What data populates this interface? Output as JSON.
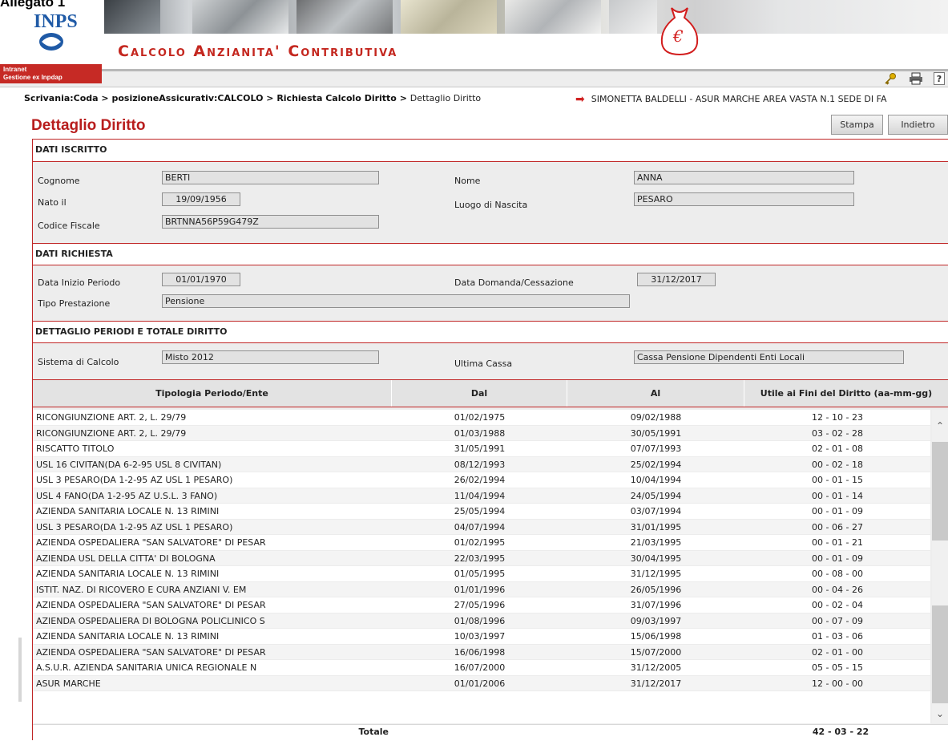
{
  "header": {
    "allegato": "Allegato 1",
    "logo_text": "INPS",
    "intranet_line1": "Intranet",
    "intranet_line2": "Gestione ex Inpdap",
    "app_title": "Calcolo Anzianita' Contributiva",
    "icons": [
      "key-icon",
      "print-icon",
      "help-icon"
    ],
    "help_label": "?"
  },
  "breadcrumb": {
    "items": [
      "Scrivania:Coda",
      "posizioneAssicurativ:CALCOLO",
      "Richiesta Calcolo Diritto",
      "Dettaglio Diritto"
    ],
    "separator": " > "
  },
  "user": {
    "text": "SIMONETTA BALDELLI  - ASUR MARCHE AREA VASTA N.1 SEDE DI FA"
  },
  "page": {
    "title": "Dettaglio Diritto",
    "buttons": {
      "stampa": "Stampa",
      "indietro": "Indietro"
    }
  },
  "iscritto": {
    "section_title": "DATI ISCRITTO",
    "cognome_label": "Cognome",
    "cognome": "BERTI",
    "nome_label": "Nome",
    "nome": "ANNA",
    "nato_label": "Nato il",
    "nato": "19/09/1956",
    "luogo_label": "Luogo di Nascita",
    "luogo": "PESARO",
    "cf_label": "Codice Fiscale",
    "cf": "BRTNNA56P59G479Z"
  },
  "richiesta": {
    "section_title": "DATI RICHIESTA",
    "inizio_label": "Data Inizio Periodo",
    "inizio": "01/01/1970",
    "domanda_label": "Data Domanda/Cessazione",
    "domanda": "31/12/2017",
    "tipo_label": "Tipo Prestazione",
    "tipo": "Pensione"
  },
  "dettaglio": {
    "section_title": "DETTAGLIO PERIODI E TOTALE DIRITTO",
    "sistema_label": "Sistema di Calcolo",
    "sistema": "Misto 2012",
    "cassa_label": "Ultima Cassa",
    "cassa": "Cassa Pensione Dipendenti Enti Locali"
  },
  "table": {
    "headers": [
      "Tipologia Periodo/Ente",
      "Dal",
      "Al",
      "Utile ai Fini del Diritto (aa-mm-gg)"
    ],
    "rows": [
      [
        "RICONGIUNZIONE ART. 2, L. 29/79",
        "01/02/1975",
        "09/02/1988",
        "12 - 10 - 23"
      ],
      [
        "RICONGIUNZIONE ART. 2, L. 29/79",
        "01/03/1988",
        "30/05/1991",
        "03 - 02 - 28"
      ],
      [
        "RISCATTO TITOLO",
        "31/05/1991",
        "07/07/1993",
        "02 - 01 - 08"
      ],
      [
        "USL 16 CIVITAN(DA 6-2-95 USL 8 CIVITAN)",
        "08/12/1993",
        "25/02/1994",
        "00 - 02 - 18"
      ],
      [
        "USL 3 PESARO(DA 1-2-95 AZ USL 1 PESARO)",
        "26/02/1994",
        "10/04/1994",
        "00 - 01 - 15"
      ],
      [
        "USL 4 FANO(DA 1-2-95 AZ U.S.L. 3 FANO)",
        "11/04/1994",
        "24/05/1994",
        "00 - 01 - 14"
      ],
      [
        "AZIENDA SANITARIA LOCALE N. 13 RIMINI",
        "25/05/1994",
        "03/07/1994",
        "00 - 01 - 09"
      ],
      [
        "USL 3 PESARO(DA 1-2-95 AZ USL 1 PESARO)",
        "04/07/1994",
        "31/01/1995",
        "00 - 06 - 27"
      ],
      [
        "AZIENDA OSPEDALIERA \"SAN SALVATORE\" DI PESAR",
        "01/02/1995",
        "21/03/1995",
        "00 - 01 - 21"
      ],
      [
        "AZIENDA USL DELLA CITTA' DI BOLOGNA",
        "22/03/1995",
        "30/04/1995",
        "00 - 01 - 09"
      ],
      [
        "AZIENDA SANITARIA LOCALE N. 13 RIMINI",
        "01/05/1995",
        "31/12/1995",
        "00 - 08 - 00"
      ],
      [
        "ISTIT. NAZ. DI RICOVERO E CURA ANZIANI V. EM",
        "01/01/1996",
        "26/05/1996",
        "00 - 04 - 26"
      ],
      [
        "AZIENDA OSPEDALIERA \"SAN SALVATORE\" DI PESAR",
        "27/05/1996",
        "31/07/1996",
        "00 - 02 - 04"
      ],
      [
        "AZIENDA OSPEDALIERA DI BOLOGNA POLICLINICO S",
        "01/08/1996",
        "09/03/1997",
        "00 - 07 - 09"
      ],
      [
        "AZIENDA SANITARIA LOCALE N. 13 RIMINI",
        "10/03/1997",
        "15/06/1998",
        "01 - 03 - 06"
      ],
      [
        "AZIENDA OSPEDALIERA \"SAN SALVATORE\" DI PESAR",
        "16/06/1998",
        "15/07/2000",
        "02 - 01 - 00"
      ],
      [
        "A.S.U.R. AZIENDA SANITARIA UNICA REGIONALE N",
        "16/07/2000",
        "31/12/2005",
        "05 - 05 - 15"
      ],
      [
        "ASUR MARCHE",
        "01/01/2006",
        "31/12/2017",
        "12 - 00 - 00"
      ]
    ],
    "total_label": "Totale",
    "total_value": "42 - 03 - 22"
  },
  "colors": {
    "accent_red": "#c02626",
    "title_red": "#b81d1d",
    "panel_gray": "#ededed"
  }
}
